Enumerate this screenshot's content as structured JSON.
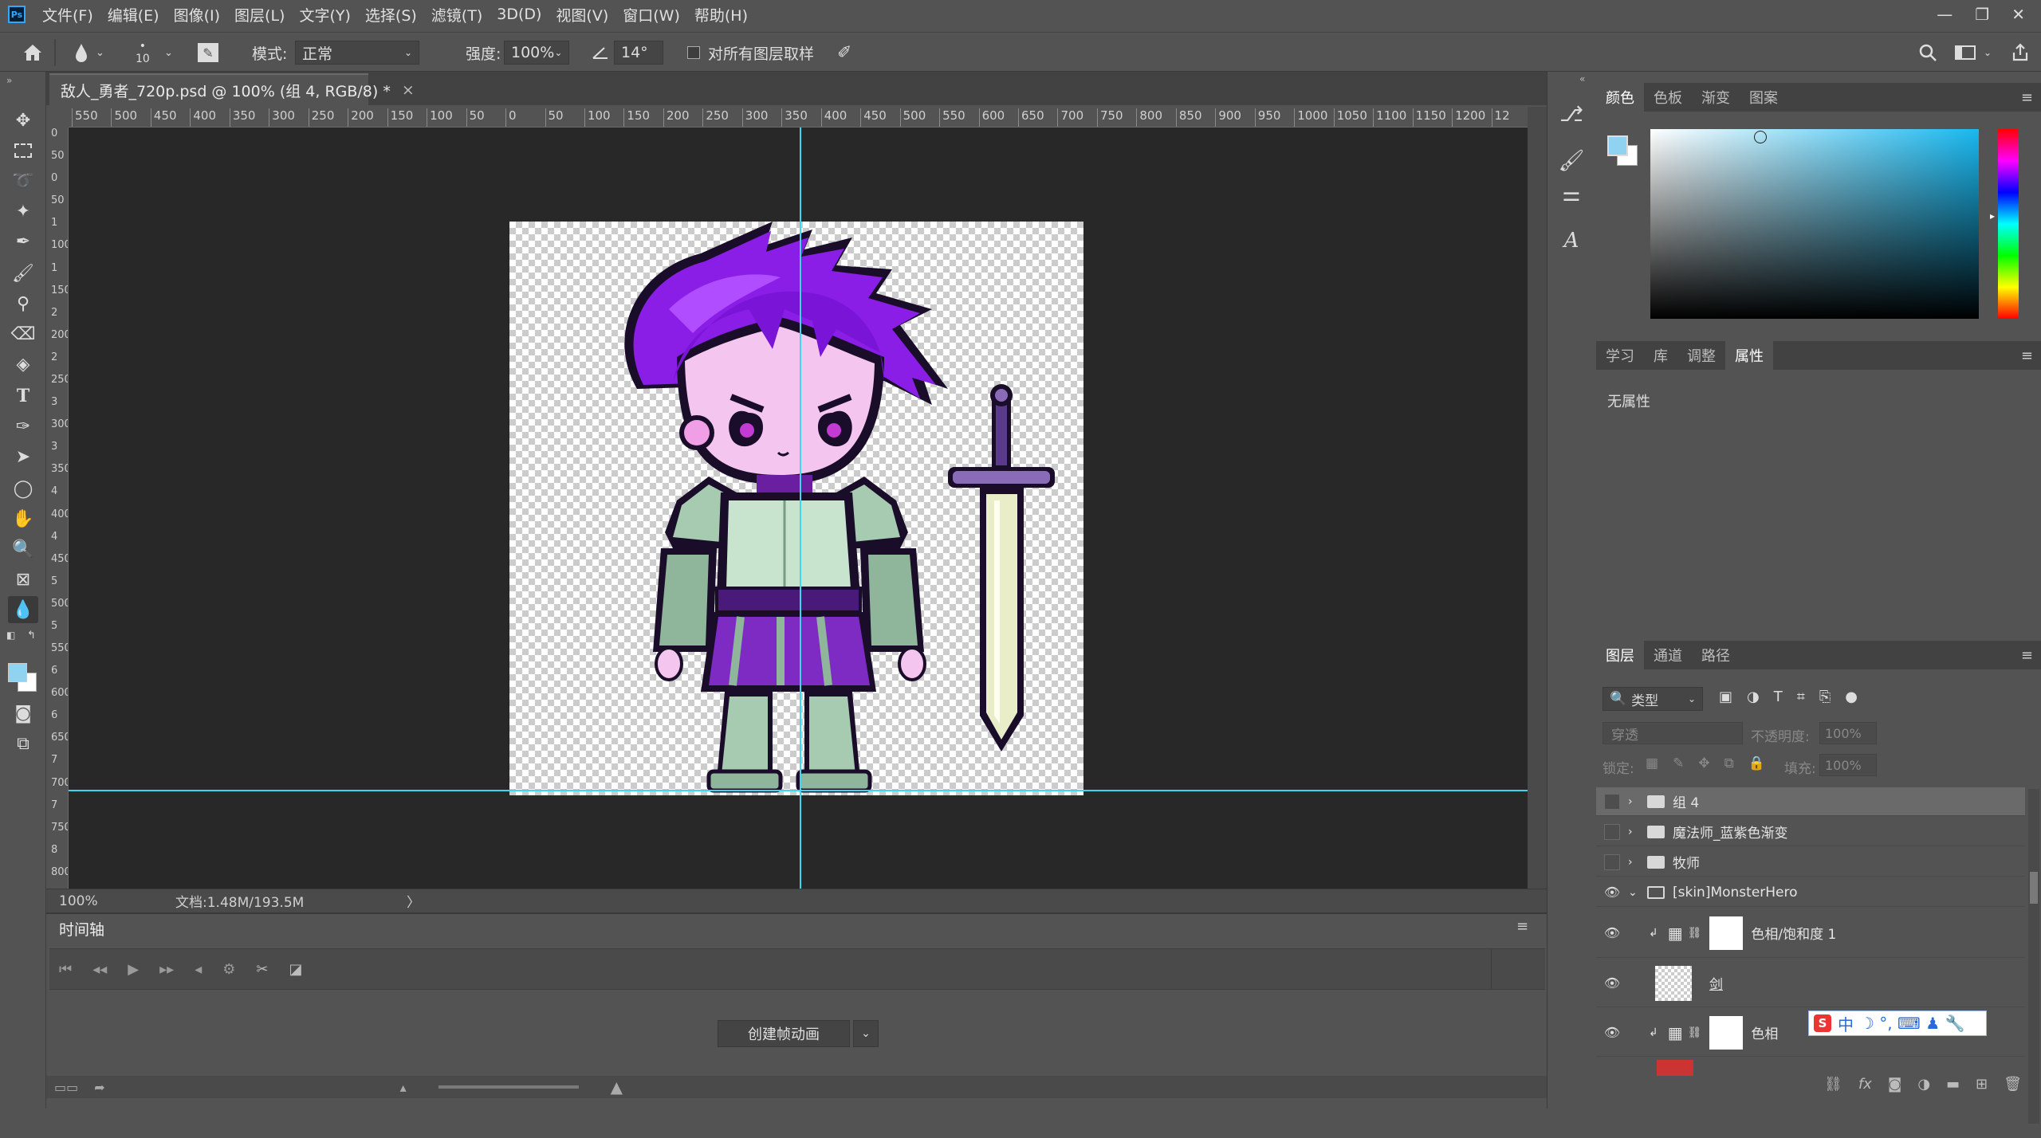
{
  "menu": {
    "items": [
      "文件(F)",
      "编辑(E)",
      "图像(I)",
      "图层(L)",
      "文字(Y)",
      "选择(S)",
      "滤镜(T)",
      "3D(D)",
      "视图(V)",
      "窗口(W)",
      "帮助(H)"
    ]
  },
  "window_controls": {
    "minimize": "—",
    "restore": "❐",
    "close": "✕"
  },
  "options": {
    "brush_size": "10",
    "mode_label": "模式:",
    "mode_value": "正常",
    "strength_label": "强度:",
    "strength_value": "100%",
    "angle_value": "14°",
    "sample_all_label": "对所有图层取样"
  },
  "document": {
    "tab_title": "敌人_勇者_720p.psd @ 100% (组 4, RGB/8) *",
    "close": "×"
  },
  "ruler": {
    "h_ticks": [
      "550",
      "500",
      "450",
      "400",
      "350",
      "300",
      "250",
      "200",
      "150",
      "100",
      "50",
      "0",
      "50",
      "100",
      "150",
      "200",
      "250",
      "300",
      "350",
      "400",
      "450",
      "500",
      "550",
      "600",
      "650",
      "700",
      "750",
      "800",
      "850",
      "900",
      "950",
      "1000",
      "1050",
      "1100",
      "1150",
      "1200",
      "12"
    ],
    "v_ticks": [
      "0",
      "50",
      "0",
      "50",
      "1",
      "100",
      "1",
      "150",
      "2",
      "200",
      "2",
      "250",
      "3",
      "300",
      "3",
      "350",
      "4",
      "400",
      "4",
      "450",
      "5",
      "500",
      "5",
      "550",
      "6",
      "600",
      "6",
      "650",
      "7",
      "700",
      "7",
      "750",
      "8",
      "800"
    ]
  },
  "status": {
    "zoom": "100%",
    "doc_size": "文档:1.48M/193.5M",
    "arrow": "〉"
  },
  "timeline": {
    "tab": "时间轴",
    "create_button": "创建帧动画"
  },
  "color_panel": {
    "tabs": [
      "颜色",
      "色板",
      "渐变",
      "图案"
    ],
    "fg_color": "#8fd3f0",
    "bg_color": "#ffffff",
    "hue_color": "#19b8f0"
  },
  "properties_panel": {
    "tabs": [
      "学习",
      "库",
      "调整",
      "属性"
    ],
    "empty_text": "无属性"
  },
  "layers_panel": {
    "tabs": [
      "图层",
      "通道",
      "路径"
    ],
    "filter_label": "类型",
    "blend_mode": "穿透",
    "opacity_label": "不透明度:",
    "opacity_value": "100%",
    "lock_label": "锁定:",
    "fill_label": "填充:",
    "fill_value": "100%",
    "layers": [
      {
        "name": "组 4",
        "type": "group",
        "visible": false,
        "selected": true
      },
      {
        "name": "魔法师_蓝紫色渐变",
        "type": "group",
        "visible": false
      },
      {
        "name": "牧师",
        "type": "group",
        "visible": false
      },
      {
        "name": "[skin]MonsterHero",
        "type": "group",
        "visible": true,
        "expanded": true
      },
      {
        "name": "色相/饱和度 1",
        "type": "adjustment",
        "visible": true
      },
      {
        "name": "剑",
        "type": "pixel",
        "visible": true
      },
      {
        "name": "色相",
        "type": "adjustment",
        "visible": true
      }
    ]
  },
  "ime": {
    "label": "中",
    "symbols": "☽ °, ⌨ ♟ 🔧"
  }
}
